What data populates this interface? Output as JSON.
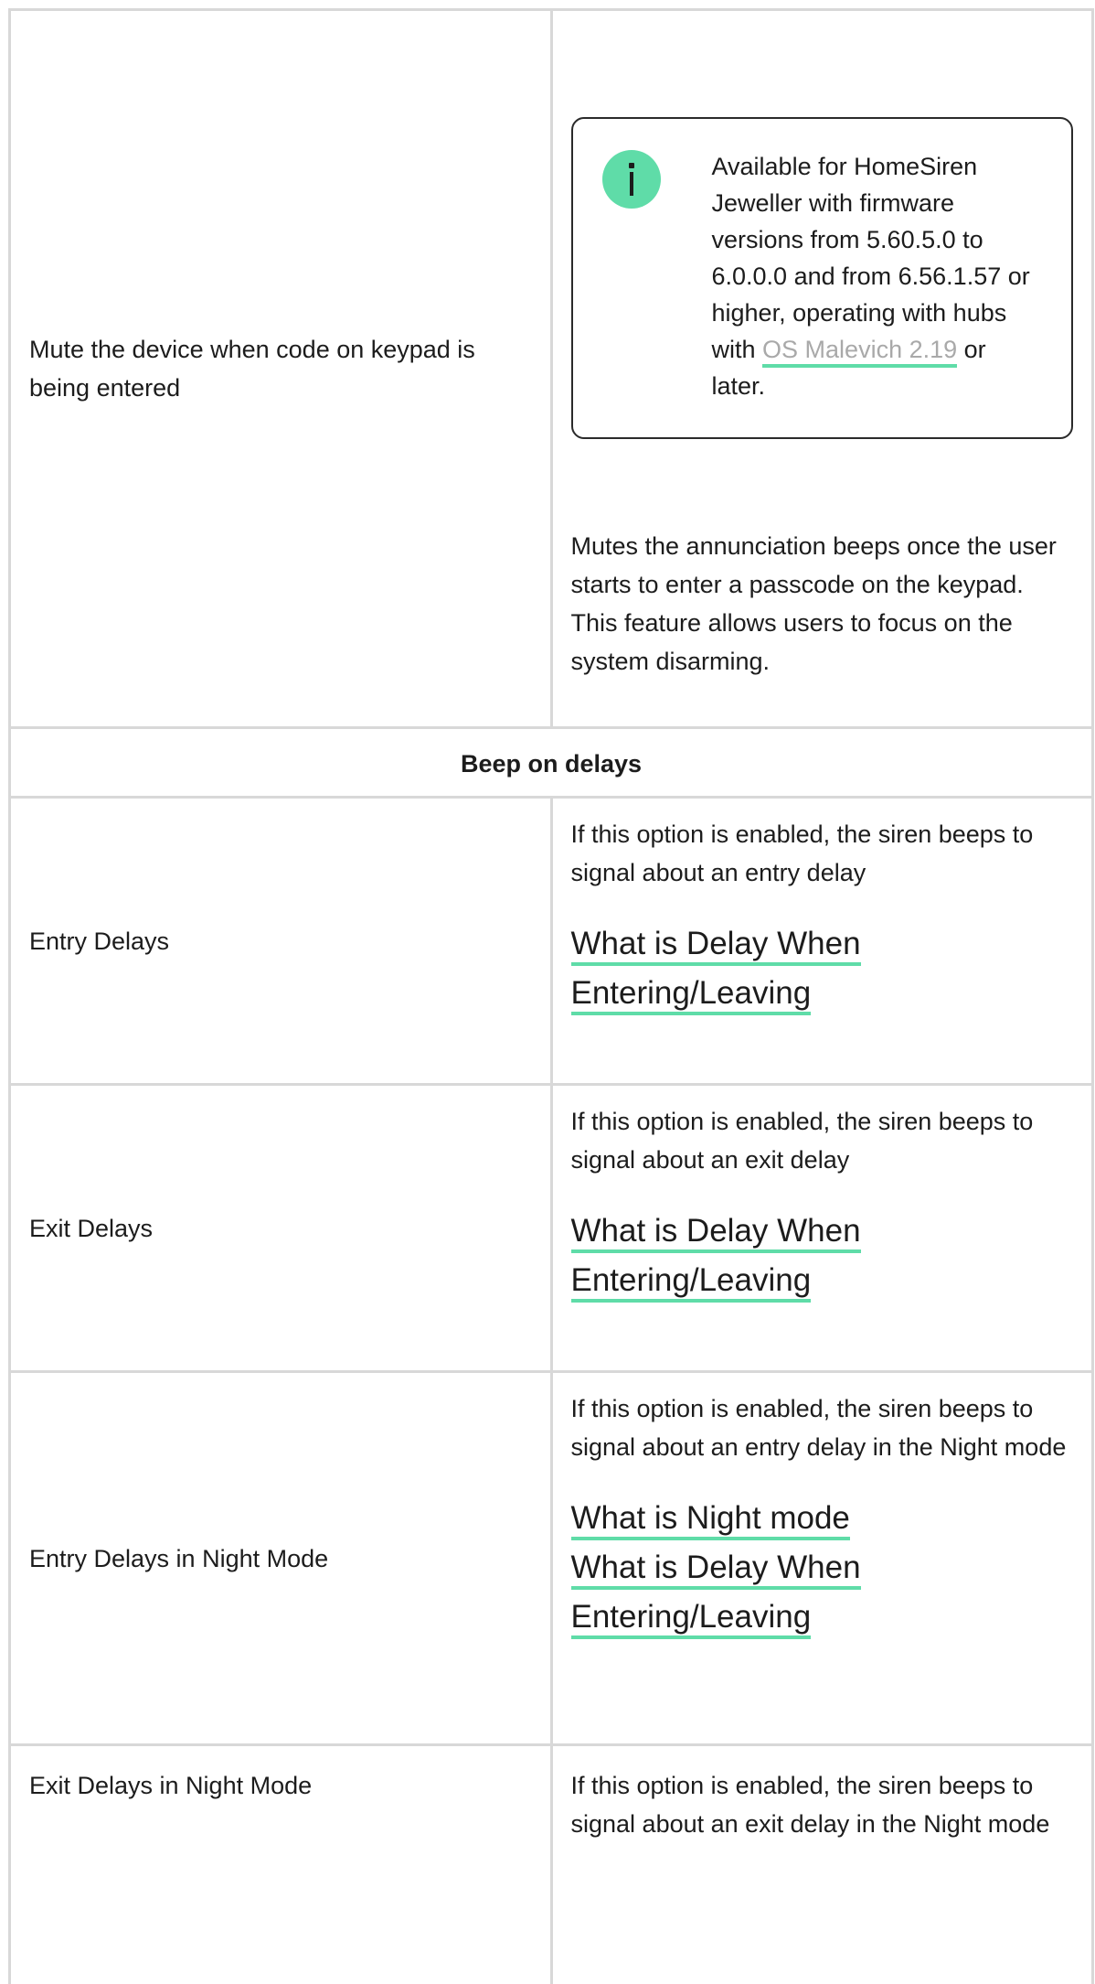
{
  "rows": {
    "mute": {
      "label": "Mute the device when code on keypad is being entered",
      "info": {
        "text_before": "Available for HomeSiren Jeweller with firmware versions from 5.60.5.0 to 6.0.0.0 and from 6.56.1.57 or higher, operating with hubs with ",
        "link": "OS Malevich 2.19",
        "text_after": " or later."
      },
      "description": "Mutes the annunciation beeps once the user starts to enter a passcode on the keypad. This feature allows users to focus on the system disarming."
    },
    "section_header": "Beep on delays",
    "entry": {
      "label": "Entry Delays",
      "description": "If this option is enabled, the siren beeps to signal about an entry delay",
      "link_line1": "What is Delay When",
      "link_line2": "Entering/Leaving"
    },
    "exit": {
      "label": "Exit Delays",
      "description": "If this option is enabled, the siren beeps to signal about an exit delay",
      "link_line1": "What is Delay When",
      "link_line2": "Entering/Leaving"
    },
    "entry_night": {
      "label": "Entry Delays in Night Mode",
      "description": "If this option is enabled, the siren beeps to signal about an entry delay in the Night mode",
      "link_night": "What is Night mode",
      "link_line1": "What is Delay When",
      "link_line2": "Entering/Leaving"
    },
    "exit_night": {
      "label": "Exit Delays in Night Mode",
      "description": "If this option is enabled, the siren beeps to signal about an exit delay in the Night mode"
    }
  },
  "colors": {
    "accent": "#5fdca8",
    "border": "#d8d8d8",
    "muted_link": "#a9a9a9",
    "text": "#1c1c1c"
  }
}
